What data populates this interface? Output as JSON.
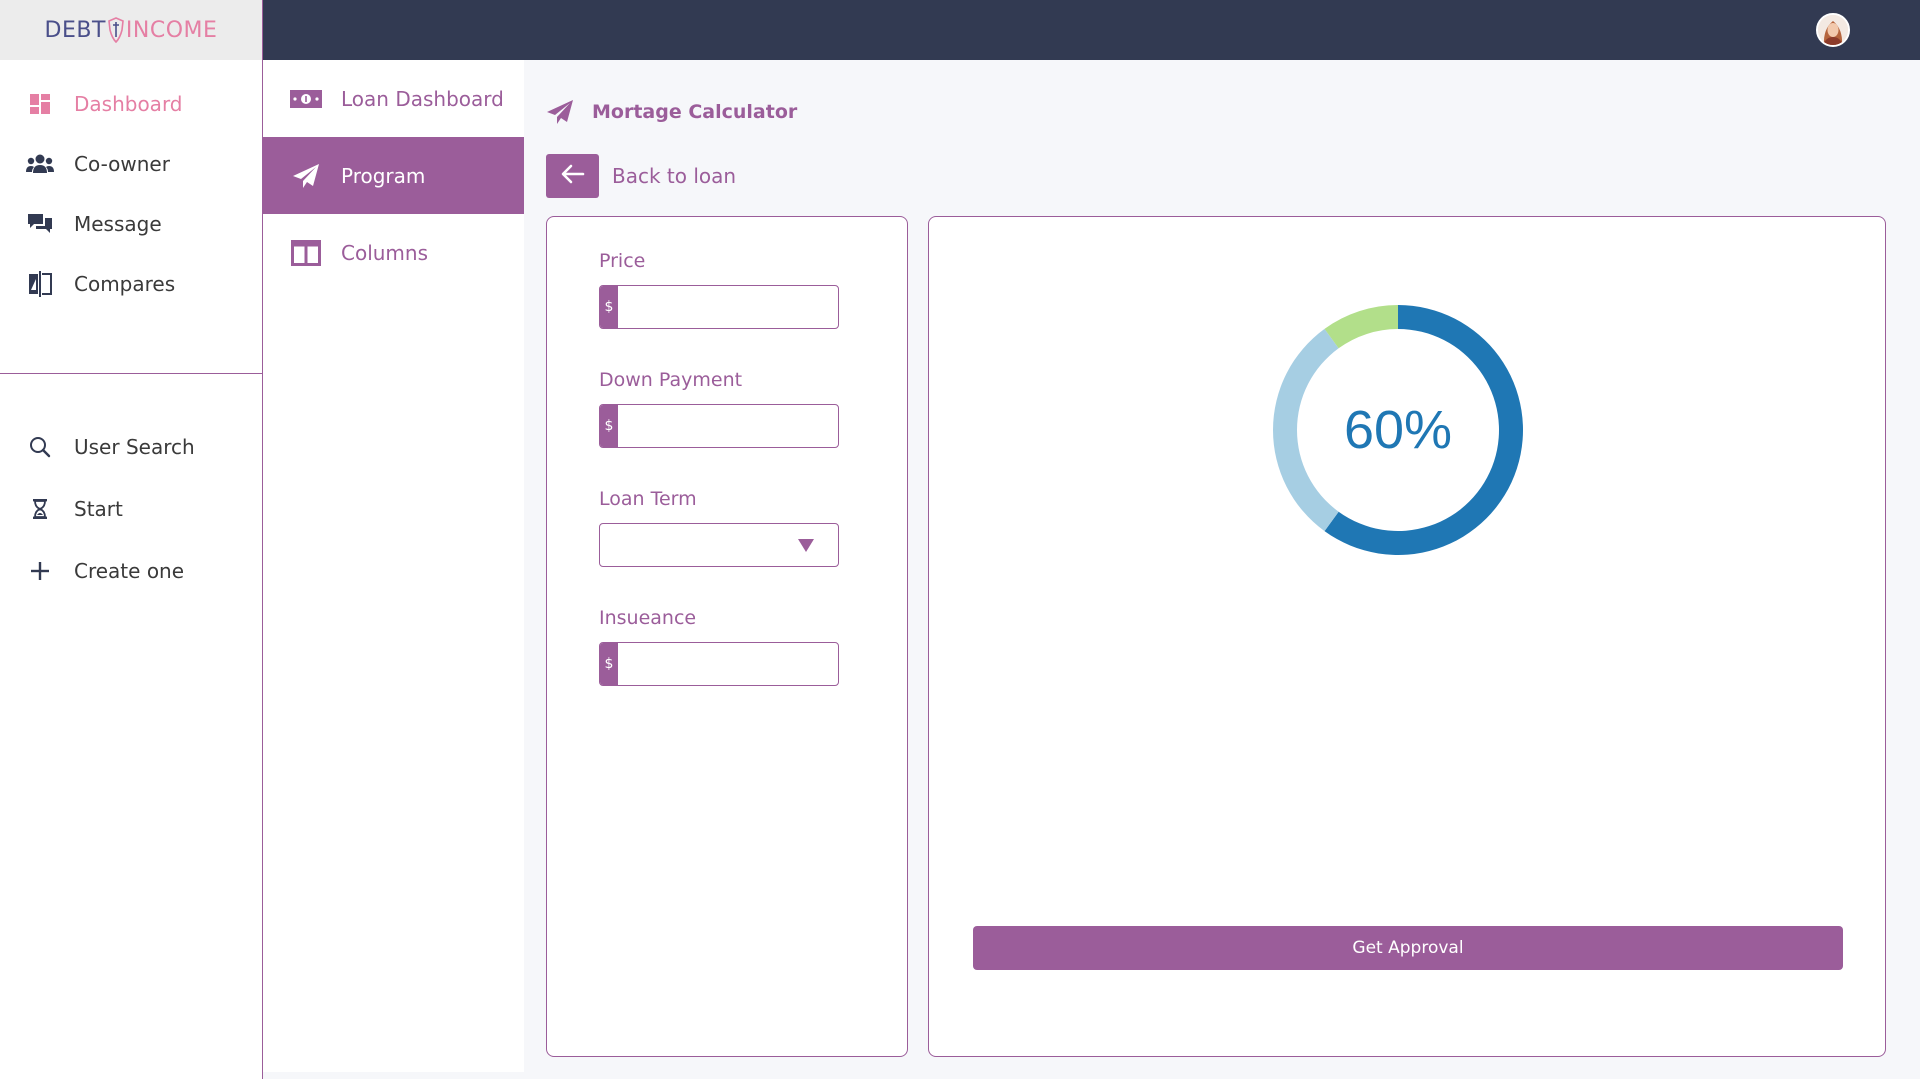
{
  "logo": {
    "left": "DEBT",
    "right": "INCOME"
  },
  "sidebar": {
    "items": [
      {
        "label": "Dashboard",
        "icon": "dashboard-icon",
        "active": true
      },
      {
        "label": "Co-owner",
        "icon": "users-icon"
      },
      {
        "label": "Message",
        "icon": "chat-icon"
      },
      {
        "label": "Compares",
        "icon": "compare-icon"
      }
    ],
    "secondary": [
      {
        "label": "User Search",
        "icon": "search-icon"
      },
      {
        "label": "Start",
        "icon": "hourglass-icon"
      },
      {
        "label": "Create one",
        "icon": "plus-icon"
      }
    ]
  },
  "subnav": {
    "items": [
      {
        "label": "Loan Dashboard",
        "icon": "money-icon"
      },
      {
        "label": "Program",
        "icon": "paper-plane-icon",
        "active": true
      },
      {
        "label": "Columns",
        "icon": "columns-icon"
      }
    ]
  },
  "page": {
    "title": "Mortage Calculator",
    "title_icon": "paper-plane-icon",
    "back_label": "Back to loan"
  },
  "form": {
    "price": {
      "label": "Price",
      "prefix": "$",
      "value": ""
    },
    "down_payment": {
      "label": "Down Payment",
      "prefix": "$",
      "value": ""
    },
    "loan_term": {
      "label": "Loan Term",
      "value": ""
    },
    "insurance": {
      "label": "Insueance",
      "prefix": "$",
      "value": ""
    }
  },
  "result": {
    "percent_label": "60%",
    "approve_label": "Get Approval"
  },
  "chart_data": {
    "type": "pie",
    "variant": "donut",
    "center_label": "60%",
    "values": [
      60,
      30,
      10
    ],
    "colors": [
      "#1f77b4",
      "#a6cee3",
      "#b2df8a"
    ]
  },
  "colors": {
    "accent": "#9b5d9a",
    "topbar": "#323a52",
    "active_nav": "#e57fa4"
  },
  "user": {
    "avatar_icon": "user-avatar"
  }
}
